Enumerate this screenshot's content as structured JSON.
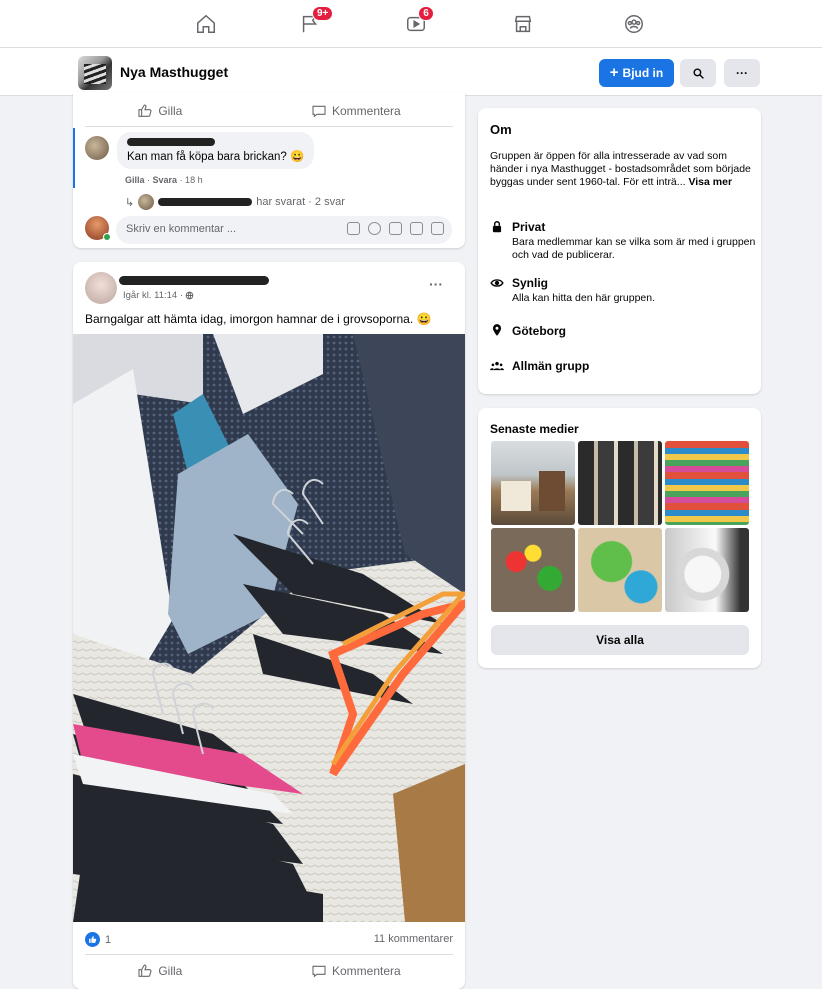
{
  "nav": {
    "icons": [
      "home-icon",
      "flag-icon",
      "video-icon",
      "marketplace-icon",
      "groups-icon"
    ],
    "pages_badge": "9+",
    "watch_badge": "6"
  },
  "group": {
    "name": "Nya Masthugget",
    "invite_label": "Bjud in",
    "search_icon": "search-icon",
    "more_label": "···"
  },
  "post1": {
    "like_label": "Gilla",
    "comment_label": "Kommentera",
    "comment_text": "Kan man få köpa bara brickan? 😀",
    "comment_meta_like": "Gilla",
    "comment_meta_reply": "Svara",
    "comment_meta_time": "· 18 h",
    "replies_text": "har svarat · 2 svar",
    "write_placeholder": "Skriv en kommentar ..."
  },
  "post2": {
    "time": "Igår kl. 11:14 · ",
    "more": "···",
    "text": "Barngalgar att hämta idag, imorgon hamnar de i grovsoporna. 😀",
    "reactions": "1",
    "comments_count": "11 kommentarer",
    "like_label": "Gilla",
    "comment_label": "Kommentera"
  },
  "about": {
    "title": "Om",
    "description": "Gruppen är öppen för alla intresserade av vad som händer i nya Masthugget - bostadsområdet som började byggas under sent 1960-tal. För ett inträ...",
    "see_more": "Visa mer",
    "private_title": "Privat",
    "private_desc": "Bara medlemmar kan se vilka som är med i gruppen och vad de publicerar.",
    "visible_title": "Synlig",
    "visible_desc": "Alla kan hitta den här gruppen.",
    "location": "Göteborg",
    "group_type": "Allmän grupp"
  },
  "media": {
    "title": "Senaste medier",
    "see_all": "Visa alla"
  },
  "colors": {
    "accent": "#1b74e4",
    "badge": "#e41e3f",
    "background": "#f0f2f5"
  }
}
